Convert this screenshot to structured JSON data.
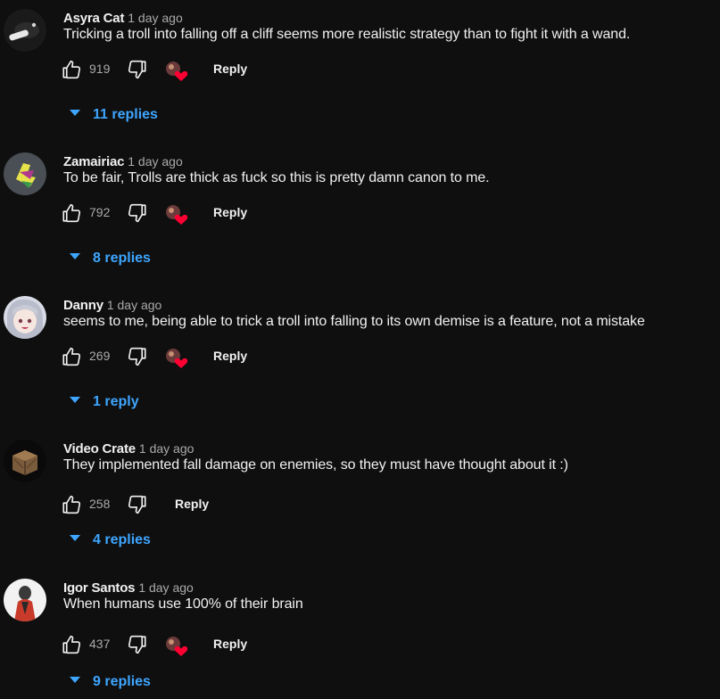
{
  "comments": [
    {
      "author": "Asyra Cat",
      "time": "1 day ago",
      "text": "Tricking a troll into falling off a cliff seems more realistic strategy than to fight it with a wand.",
      "likes": "919",
      "reply_label": "Reply",
      "replies_label": "11 replies",
      "hearted": true
    },
    {
      "author": "Zamairiac",
      "time": "1 day ago",
      "text": "To be fair, Trolls are thick as fuck so this is pretty damn canon to me.",
      "likes": "792",
      "reply_label": "Reply",
      "replies_label": "8 replies",
      "hearted": true
    },
    {
      "author": "Danny",
      "time": "1 day ago",
      "text": "seems to me, being able to trick a troll into falling to its own demise is a feature, not a mistake",
      "likes": "269",
      "reply_label": "Reply",
      "replies_label": "1 reply",
      "hearted": true
    },
    {
      "author": "Video Crate",
      "time": "1 day ago",
      "text": "They implemented fall damage on enemies, so they must have thought about it :)",
      "likes": "258",
      "reply_label": "Reply",
      "replies_label": "4 replies",
      "hearted": false
    },
    {
      "author": "Igor Santos",
      "time": "1 day ago",
      "text": "When humans use 100% of their brain",
      "likes": "437",
      "reply_label": "Reply",
      "replies_label": "9 replies",
      "hearted": true
    }
  ],
  "colors": {
    "background": "#0f0f0f",
    "text": "#f1f1f1",
    "secondary_text": "#aaaaaa",
    "link_blue": "#3ea6ff",
    "heart_red": "#ff0033"
  },
  "icons": {
    "like": "thumbs-up-icon",
    "dislike": "thumbs-down-icon",
    "creator_heart": "creator-heart-icon",
    "expand": "caret-down-icon"
  }
}
